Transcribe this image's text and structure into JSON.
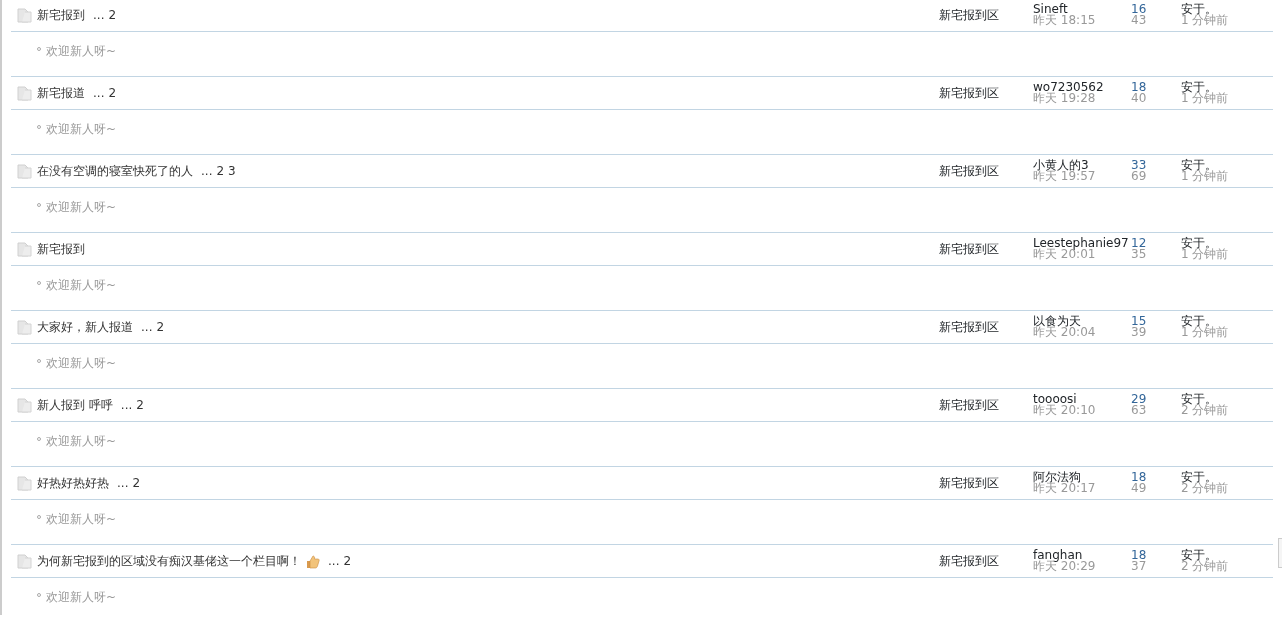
{
  "threads": [
    {
      "title": "新宅报到",
      "ellipsis": "...",
      "pages": [
        "2"
      ],
      "forum": "新宅报到区",
      "author": "Sineft",
      "date": "昨天 18:15",
      "replies": "16",
      "views": "43",
      "last_poster": "安于。",
      "last_time": "1 分钟前",
      "summary": "欢迎新人呀~"
    },
    {
      "title": "新宅报道",
      "ellipsis": "...",
      "pages": [
        "2"
      ],
      "forum": "新宅报到区",
      "author": "wo7230562",
      "date": "昨天 19:28",
      "replies": "18",
      "views": "40",
      "last_poster": "安于。",
      "last_time": "1 分钟前",
      "summary": "欢迎新人呀~"
    },
    {
      "title": "在没有空调的寝室快死了的人",
      "ellipsis": "...",
      "pages": [
        "2",
        "3"
      ],
      "forum": "新宅报到区",
      "author": "小黄人的3",
      "date": "昨天 19:57",
      "replies": "33",
      "views": "69",
      "last_poster": "安于。",
      "last_time": "1 分钟前",
      "summary": "欢迎新人呀~"
    },
    {
      "title": "新宅报到",
      "forum": "新宅报到区",
      "author": "Leestephanie97",
      "date": "昨天 20:01",
      "replies": "12",
      "views": "35",
      "last_poster": "安于。",
      "last_time": "1 分钟前",
      "summary": "欢迎新人呀~"
    },
    {
      "title": "大家好，新人报道",
      "ellipsis": "...",
      "pages": [
        "2"
      ],
      "forum": "新宅报到区",
      "author": "以食为天",
      "date": "昨天 20:04",
      "replies": "15",
      "views": "39",
      "last_poster": "安于。",
      "last_time": "1 分钟前",
      "summary": "欢迎新人呀~"
    },
    {
      "title": "新人报到 呼呼",
      "ellipsis": "...",
      "pages": [
        "2"
      ],
      "forum": "新宅报到区",
      "author": "toooosi",
      "date": "昨天 20:10",
      "replies": "29",
      "views": "63",
      "last_poster": "安于。",
      "last_time": "2 分钟前",
      "summary": "欢迎新人呀~"
    },
    {
      "title": "好热好热好热",
      "ellipsis": "...",
      "pages": [
        "2"
      ],
      "forum": "新宅报到区",
      "author": "阿尔法狗",
      "date": "昨天 20:17",
      "replies": "18",
      "views": "49",
      "last_poster": "安于。",
      "last_time": "2 分钟前",
      "summary": "欢迎新人呀~"
    },
    {
      "title": "为何新宅报到的区域没有痴汉基佬这一个栏目啊！",
      "emoji": true,
      "ellipsis": "...",
      "pages": [
        "2"
      ],
      "forum": "新宅报到区",
      "author": "fanghan",
      "date": "昨天 20:29",
      "replies": "18",
      "views": "37",
      "last_poster": "安于。",
      "last_time": "2 分钟前",
      "summary": "欢迎新人呀~"
    }
  ]
}
